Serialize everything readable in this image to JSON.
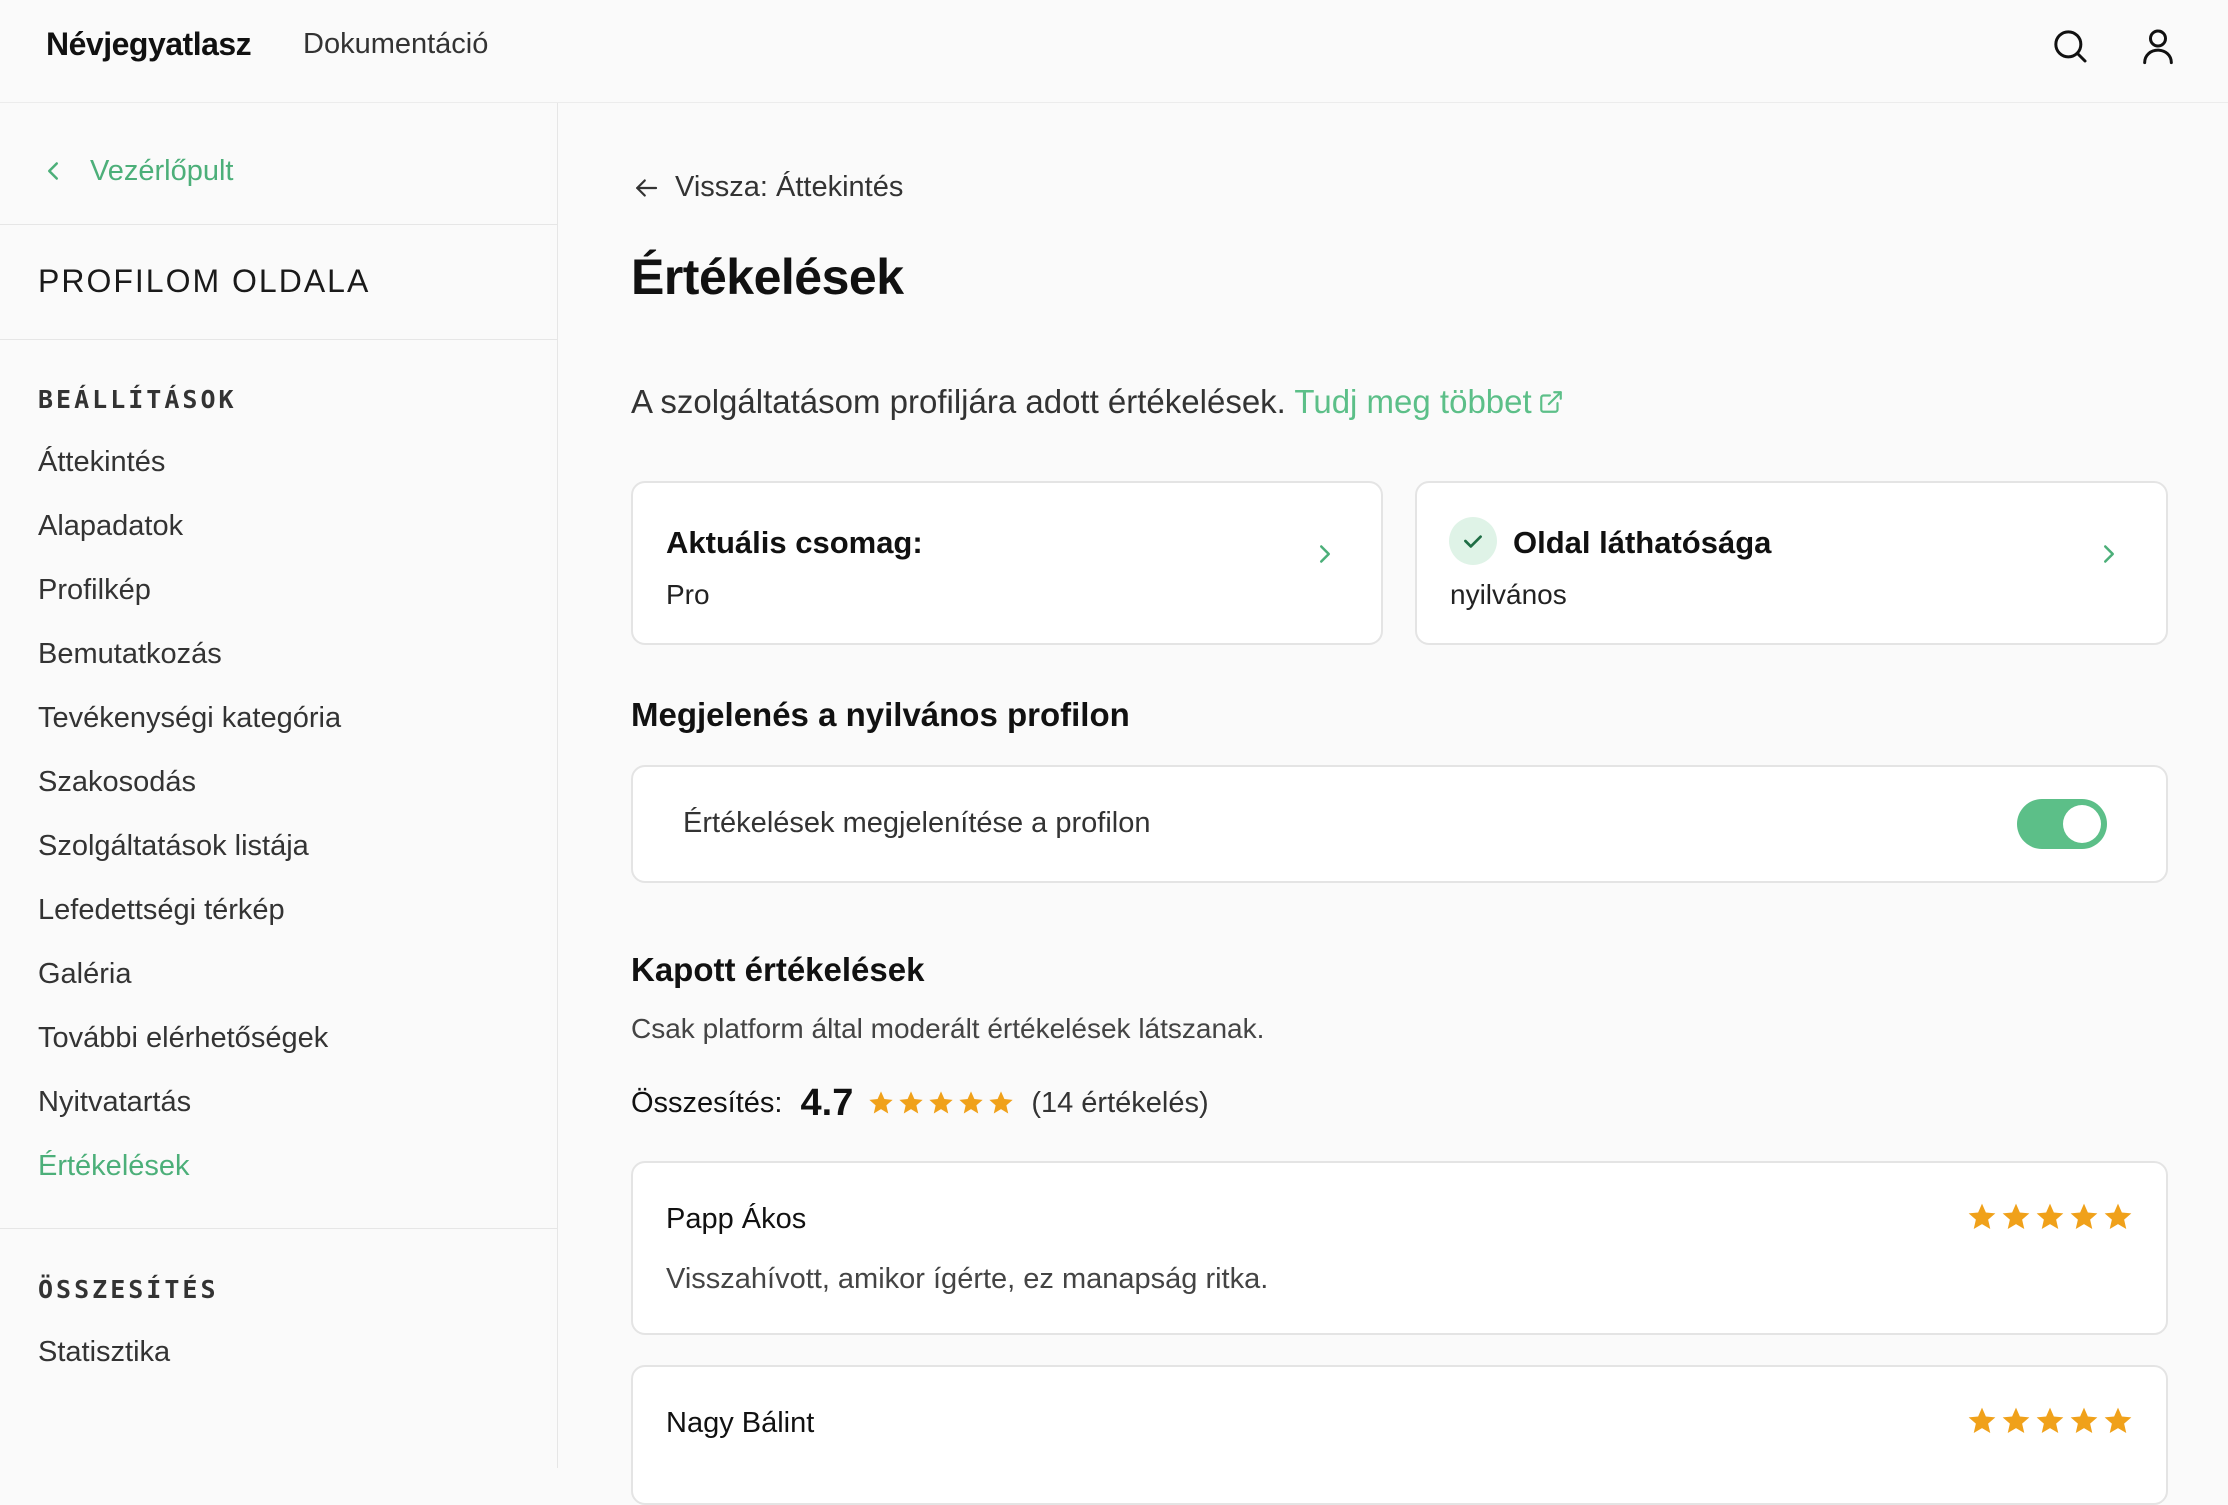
{
  "topbar": {
    "brand": "Névjegyatlasz",
    "nav_docs": "Dokumentáció",
    "icons": [
      "search-icon",
      "user-icon"
    ]
  },
  "sidebar": {
    "back_label": "Vezérlőpult",
    "title": "PROFILOM OLDALA",
    "section_settings": "BEÁLLÍTÁSOK",
    "items": [
      {
        "label": "Áttekintés",
        "active": false
      },
      {
        "label": "Alapadatok",
        "active": false
      },
      {
        "label": "Profilkép",
        "active": false
      },
      {
        "label": "Bemutatkozás",
        "active": false
      },
      {
        "label": "Tevékenységi kategória",
        "active": false
      },
      {
        "label": "Szakosodás",
        "active": false
      },
      {
        "label": "Szolgáltatások listája",
        "active": false
      },
      {
        "label": "Lefedettségi térkép",
        "active": false
      },
      {
        "label": "Galéria",
        "active": false
      },
      {
        "label": "További elérhetőségek",
        "active": false
      },
      {
        "label": "Nyitvatartás",
        "active": false
      },
      {
        "label": "Értékelések",
        "active": true
      }
    ],
    "section_summary": "ÖSSZESÍTÉS",
    "summary_items": [
      {
        "label": "Statisztika"
      }
    ]
  },
  "main": {
    "back_label": "Vissza: Áttekintés",
    "title": "Értékelések",
    "intro_text": "A szolgáltatásom profiljára adott értékelések.",
    "learn_more": "Tudj meg többet",
    "plan_card": {
      "title": "Aktuális csomag:",
      "value": "Pro"
    },
    "visibility_card": {
      "title": "Oldal láthatósága",
      "value": "nyilvános"
    },
    "public_section_title": "Megjelenés a nyilvános profilon",
    "toggle_label": "Értékelések megjelenítése a profilon",
    "toggle_on": true,
    "reviews_title": "Kapott értékelések",
    "reviews_note": "Csak platform által moderált értékelések látszanak.",
    "summary_label": "Összesítés:",
    "average": "4.7",
    "average_stars": 5,
    "count_text": "(14 értékelés)",
    "reviews": [
      {
        "name": "Papp Ákos",
        "rating": 5,
        "text": "Visszahívott, amikor ígérte, ez manapság ritka."
      },
      {
        "name": "Nagy Bálint",
        "rating": 5,
        "text": ""
      }
    ]
  },
  "colors": {
    "accent": "#4caf79",
    "toggle": "#5cbf88",
    "star": "#f0a11a"
  }
}
